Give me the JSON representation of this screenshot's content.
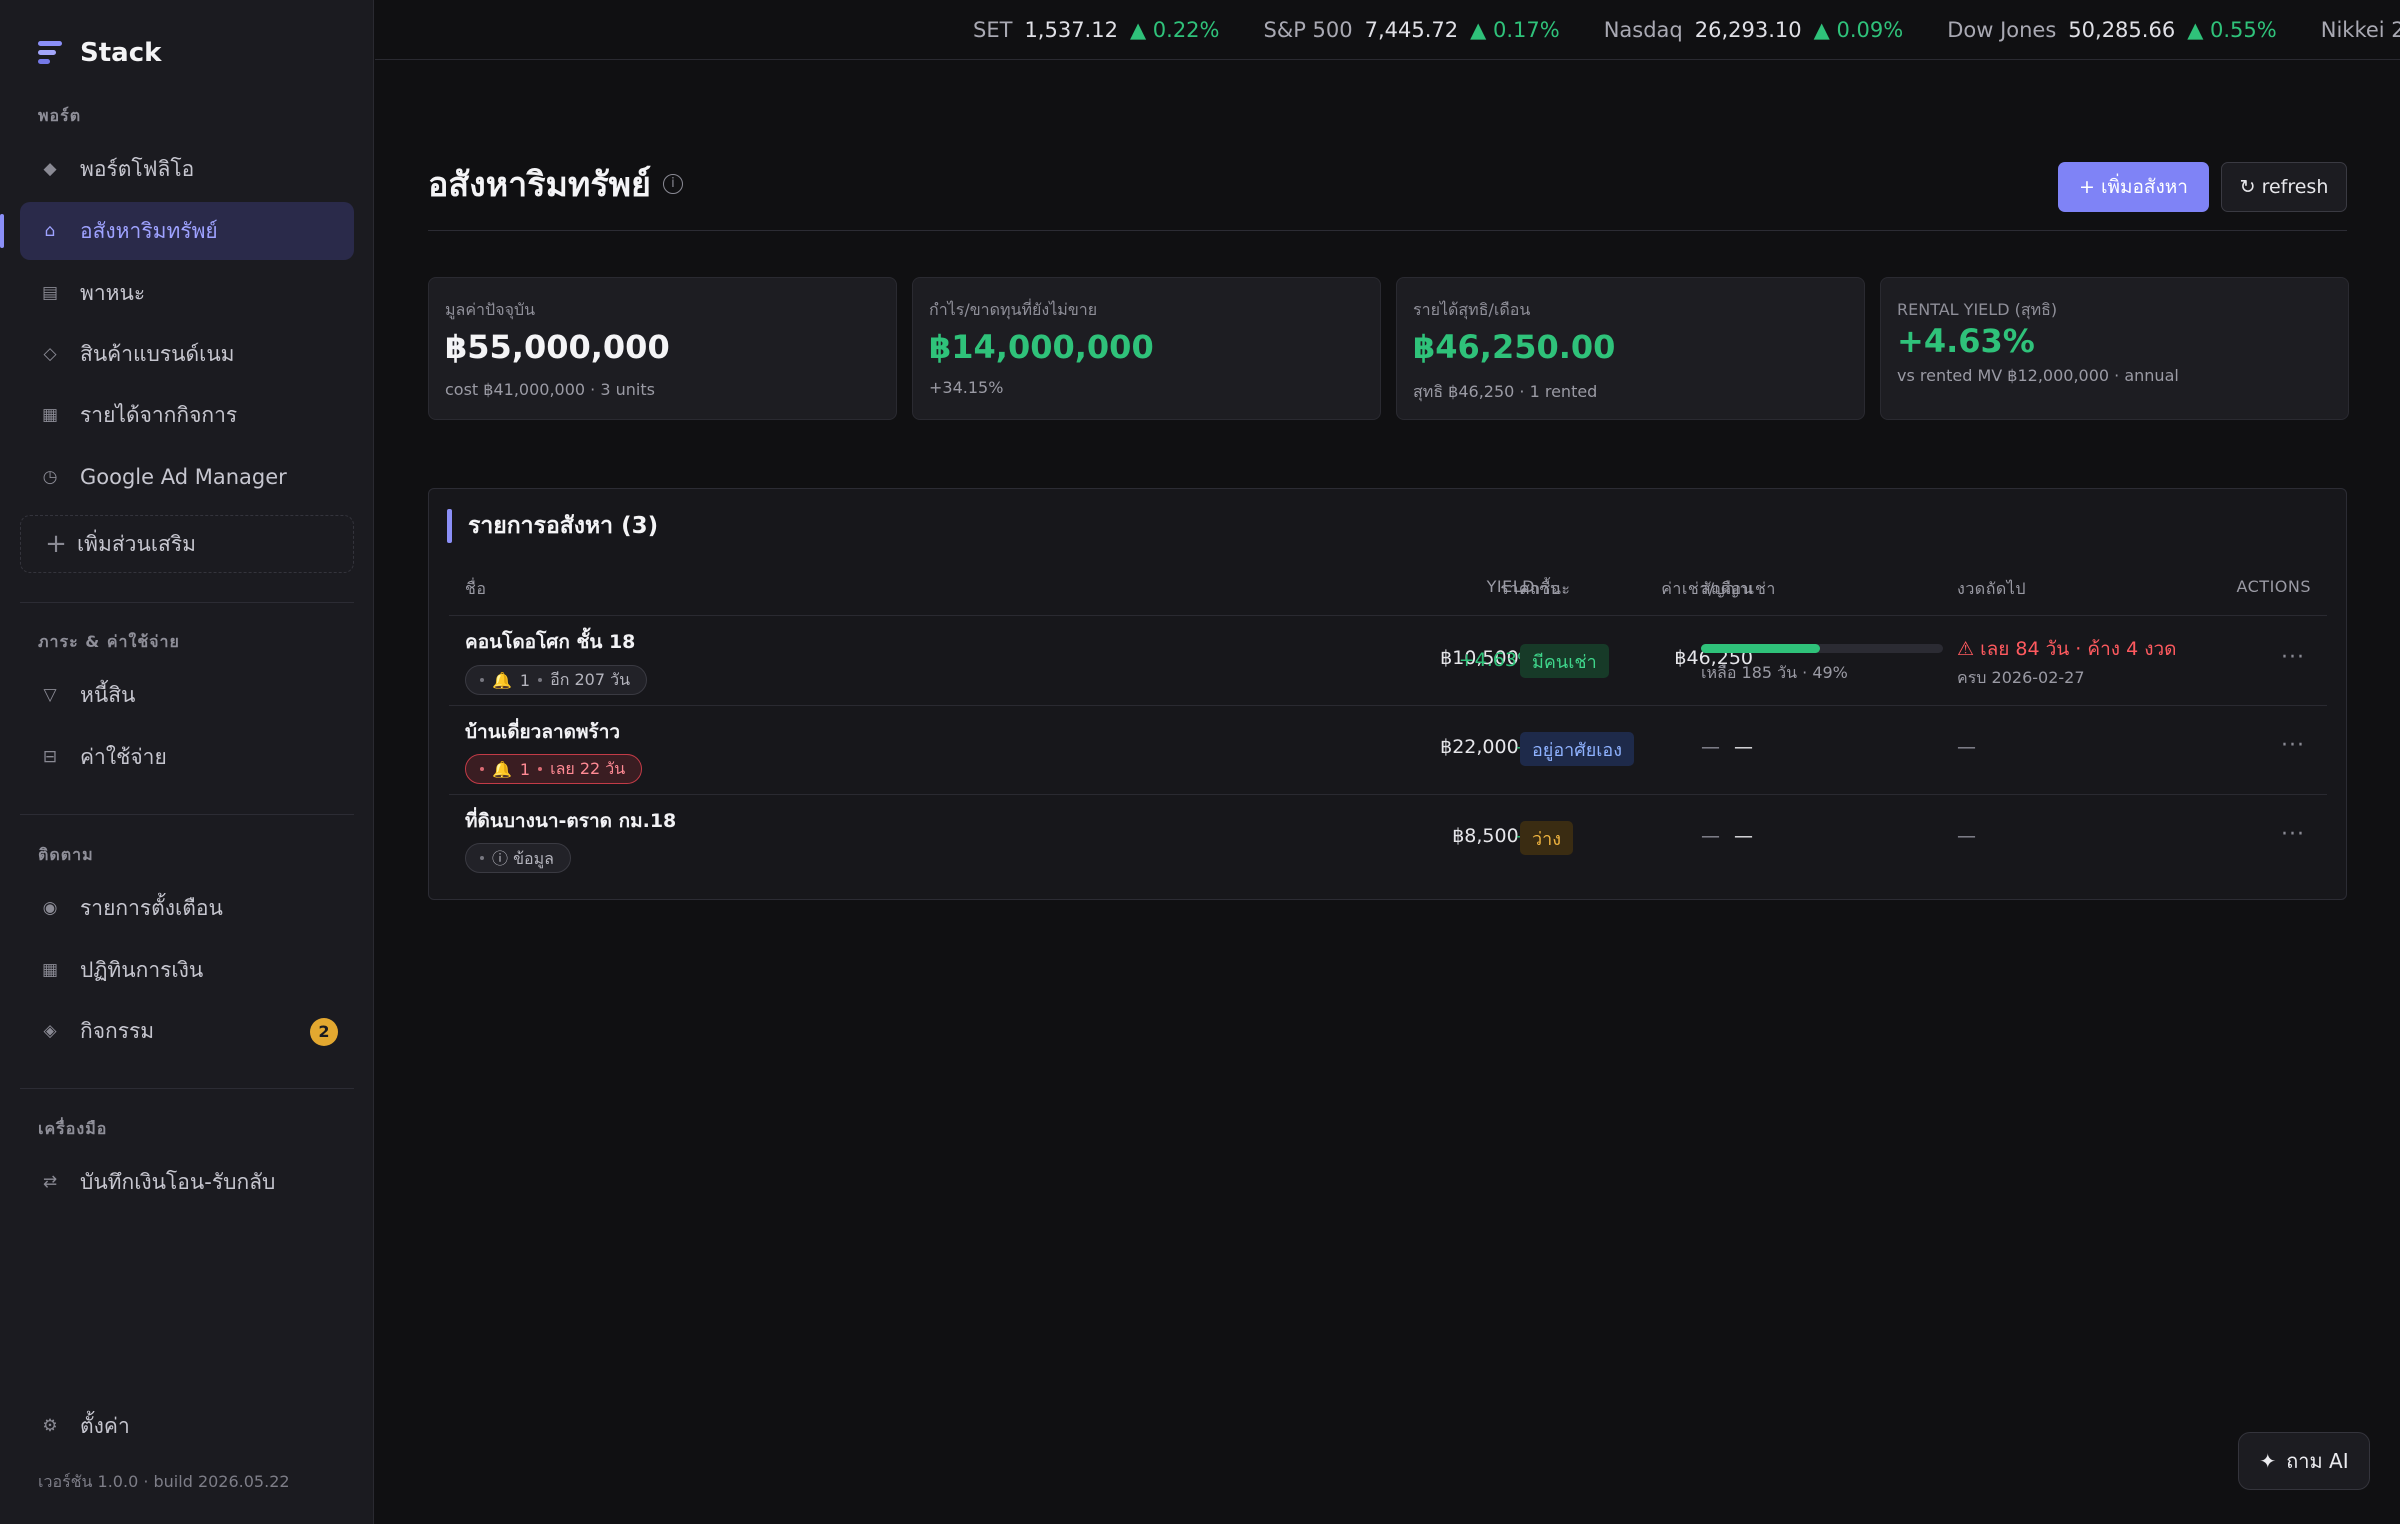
{
  "sidebar": {
    "brand": "Stack",
    "sections": {
      "portfolio": "พอร์ต",
      "debt_expense": "ภาระ & ค่าใช้จ่าย",
      "tracking": "ติดตาม",
      "tools": "เครื่องมือ"
    },
    "items": {
      "portfolio": "พอร์ตโฟลิโอ",
      "real_estate": "อสังหาริมทรัพย์",
      "vehicles": "พาหนะ",
      "brand_goods": "สินค้าแบรนด์เนม",
      "business_income": "รายได้จากกิจการ",
      "google_ad_manager": "Google Ad Manager",
      "add_extension": "เพิ่มส่วนเสริม",
      "debts": "หนี้สิน",
      "expenses": "ค่าใช้จ่าย",
      "alerts": "รายการตั้งเตือน",
      "finance_calendar": "ปฏิทินการเงิน",
      "activity": "กิจกรรม",
      "transfer_log": "บันทึกเงินโอน-รับกลับ",
      "settings": "ตั้งค่า"
    },
    "activity_badge": "2",
    "version": "เวอร์ชัน 1.0.0 · build 2026.05.22",
    "accent_color": "#8b8ff7"
  },
  "ticker": [
    {
      "name": "SET",
      "value": "1,537.12",
      "change": "▲ 0.22%"
    },
    {
      "name": "S&P 500",
      "value": "7,445.72",
      "change": "▲ 0.17%"
    },
    {
      "name": "Nasdaq",
      "value": "26,293.10",
      "change": "▲ 0.09%"
    },
    {
      "name": "Dow Jones",
      "value": "50,285.66",
      "change": "▲ 0.55%"
    },
    {
      "name": "Nikkei 2",
      "value": "",
      "change": ""
    }
  ],
  "header": {
    "title": "อสังหาริมทรัพย์",
    "add_button": "+ เพิ่มอสังหา",
    "refresh_button": "↻ refresh"
  },
  "cards": [
    {
      "label": "มูลค่าปัจจุบัน",
      "value": "฿55,000,000",
      "sub": "cost ฿41,000,000 · 3 units"
    },
    {
      "label": "กำไร/ขาดทุนที่ยังไม่ขาย",
      "value": "฿14,000,000",
      "sub": "+34.15%"
    },
    {
      "label": "รายได้สุทธิ/เดือน",
      "value": "฿46,250.00",
      "sub": "สุทธิ ฿46,250 · 1 rented"
    },
    {
      "label": "RENTAL YIELD (สุทธิ)",
      "value": "+4.63%",
      "sub": "vs rented MV ฿12,000,000 · annual"
    }
  ],
  "table": {
    "title": "รายการอสังหา (3)",
    "columns": {
      "name": "ชื่อ",
      "price": "ราคาซื้อ",
      "rent": "ค่าเช่า/เดือน",
      "yield": "YIELD",
      "status": "สถานะ",
      "lease": "สัญญาเช่า",
      "next_due": "งวดถัดไป",
      "actions": "ACTIONS"
    },
    "rows": [
      {
        "name": "คอนโดอโศก ชั้น 18",
        "pill_count": "1",
        "pill_text": "อีก 207 วัน",
        "price": "฿10,500,000",
        "rent": "฿46,250",
        "yield": "+4.63%",
        "status": "มีคนเช่า",
        "lease_remaining": 0.49,
        "lease_text": "เหลือ 185 วัน · 49%",
        "next_due": "⚠ เลย 84 วัน · ค้าง 4 งวด",
        "next_due_sub": "ครบ 2026-02-27",
        "actions": "···"
      },
      {
        "name": "บ้านเดี่ยวลาดพร้าว",
        "pill_count": "1",
        "pill_text": "เลย 22 วัน",
        "price": "฿22,000,000",
        "rent": "—",
        "yield": "—",
        "status": "อยู่อาศัยเอง",
        "lease": "—",
        "next_due": "—",
        "actions": "···"
      },
      {
        "name": "ที่ดินบางนา-ตราด กม.18",
        "pill_text": "ⓘ ข้อมูล",
        "price": "฿8,500,000",
        "rent": "—",
        "yield": "—",
        "status": "ว่าง",
        "lease": "—",
        "next_due": "—",
        "actions": "···"
      }
    ]
  },
  "ai_button": "ถาม AI"
}
